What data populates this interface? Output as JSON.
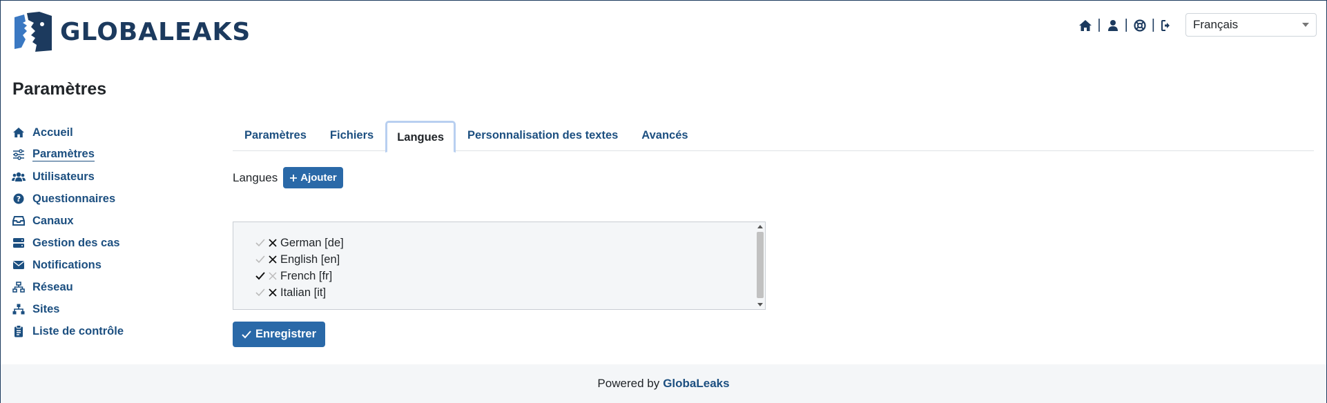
{
  "app": {
    "logo_text": "GLOBALEAKS"
  },
  "header": {
    "icons": [
      "home-icon",
      "user-icon",
      "support-icon",
      "logout-icon"
    ],
    "language_select": {
      "selected": "Français"
    }
  },
  "page": {
    "title": "Paramètres"
  },
  "sidebar": {
    "items": [
      {
        "label": "Accueil",
        "icon": "home-icon"
      },
      {
        "label": "Paramètres",
        "icon": "sliders-icon",
        "active": true
      },
      {
        "label": "Utilisateurs",
        "icon": "users-icon"
      },
      {
        "label": "Questionnaires",
        "icon": "question-icon"
      },
      {
        "label": "Canaux",
        "icon": "inbox-icon"
      },
      {
        "label": "Gestion des cas",
        "icon": "server-icon"
      },
      {
        "label": "Notifications",
        "icon": "envelope-icon"
      },
      {
        "label": "Réseau",
        "icon": "network-icon"
      },
      {
        "label": "Sites",
        "icon": "sitemap-icon"
      },
      {
        "label": "Liste de contrôle",
        "icon": "clipboard-icon"
      }
    ]
  },
  "tabs": [
    {
      "label": "Paramètres"
    },
    {
      "label": "Fichiers"
    },
    {
      "label": "Langues",
      "active": true
    },
    {
      "label": "Personnalisation des textes"
    },
    {
      "label": "Avancés"
    }
  ],
  "languages": {
    "label": "Langues",
    "add_button": "Ajouter",
    "items": [
      {
        "name": "German [de]",
        "default": false,
        "removable": true
      },
      {
        "name": "English [en]",
        "default": false,
        "removable": true
      },
      {
        "name": "French [fr]",
        "default": true,
        "removable": false
      },
      {
        "name": "Italian [it]",
        "default": false,
        "removable": true
      }
    ]
  },
  "save_button": "Enregistrer",
  "footer": {
    "prefix": "Powered by",
    "brand": "GlobaLeaks"
  },
  "colors": {
    "primary": "#2a69a8",
    "link": "#1c4f80",
    "brand_dark": "#1c3a5e",
    "footer_bg": "#f4f6f8"
  }
}
